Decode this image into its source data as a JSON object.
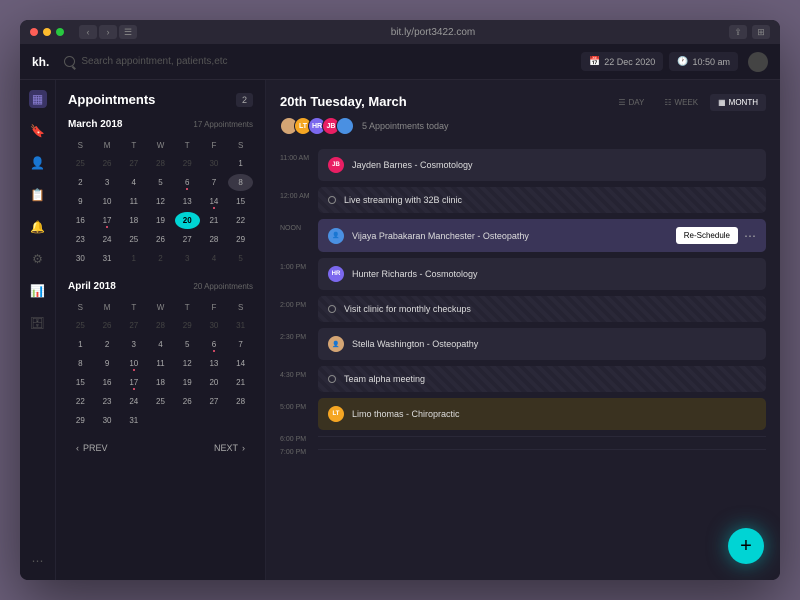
{
  "titlebar": {
    "url": "bit.ly/port3422.com"
  },
  "topbar": {
    "logo": "kh.",
    "search_placeholder": "Search appointment, patients,etc",
    "date": "22 Dec 2020",
    "time": "10:50 am"
  },
  "panel": {
    "title": "Appointments",
    "badge": "2",
    "prev": "PREV",
    "next": "NEXT"
  },
  "cal1": {
    "month": "March 2018",
    "count": "17 Appointments",
    "days": [
      {
        "n": "25",
        "dim": true
      },
      {
        "n": "26",
        "dim": true
      },
      {
        "n": "27",
        "dim": true
      },
      {
        "n": "28",
        "dim": true
      },
      {
        "n": "29",
        "dim": true
      },
      {
        "n": "30",
        "dim": true
      },
      {
        "n": "1"
      },
      {
        "n": "2"
      },
      {
        "n": "3"
      },
      {
        "n": "4"
      },
      {
        "n": "5"
      },
      {
        "n": "6",
        "dot": true
      },
      {
        "n": "7"
      },
      {
        "n": "8",
        "ring": true
      },
      {
        "n": "9"
      },
      {
        "n": "10"
      },
      {
        "n": "11"
      },
      {
        "n": "12"
      },
      {
        "n": "13"
      },
      {
        "n": "14",
        "dot": true
      },
      {
        "n": "15"
      },
      {
        "n": "16"
      },
      {
        "n": "17",
        "dot": true
      },
      {
        "n": "18"
      },
      {
        "n": "19"
      },
      {
        "n": "20",
        "sel": true
      },
      {
        "n": "21"
      },
      {
        "n": "22"
      },
      {
        "n": "23"
      },
      {
        "n": "24"
      },
      {
        "n": "25"
      },
      {
        "n": "26"
      },
      {
        "n": "27"
      },
      {
        "n": "28"
      },
      {
        "n": "29"
      },
      {
        "n": "30"
      },
      {
        "n": "31"
      },
      {
        "n": "1",
        "dim": true
      },
      {
        "n": "2",
        "dim": true
      },
      {
        "n": "3",
        "dim": true
      },
      {
        "n": "4",
        "dim": true
      },
      {
        "n": "5",
        "dim": true
      }
    ]
  },
  "cal2": {
    "month": "April 2018",
    "count": "20 Appointments",
    "days": [
      {
        "n": "25",
        "dim": true
      },
      {
        "n": "26",
        "dim": true
      },
      {
        "n": "27",
        "dim": true
      },
      {
        "n": "28",
        "dim": true
      },
      {
        "n": "29",
        "dim": true
      },
      {
        "n": "30",
        "dim": true
      },
      {
        "n": "31",
        "dim": true
      },
      {
        "n": "1"
      },
      {
        "n": "2"
      },
      {
        "n": "3"
      },
      {
        "n": "4"
      },
      {
        "n": "5"
      },
      {
        "n": "6",
        "dot": true
      },
      {
        "n": "7"
      },
      {
        "n": "8"
      },
      {
        "n": "9"
      },
      {
        "n": "10",
        "dot": true
      },
      {
        "n": "11"
      },
      {
        "n": "12"
      },
      {
        "n": "13"
      },
      {
        "n": "14"
      },
      {
        "n": "15"
      },
      {
        "n": "16"
      },
      {
        "n": "17",
        "dot": true
      },
      {
        "n": "18"
      },
      {
        "n": "19"
      },
      {
        "n": "20"
      },
      {
        "n": "21"
      },
      {
        "n": "22"
      },
      {
        "n": "23"
      },
      {
        "n": "24"
      },
      {
        "n": "25"
      },
      {
        "n": "26"
      },
      {
        "n": "27"
      },
      {
        "n": "28"
      },
      {
        "n": "29"
      },
      {
        "n": "30"
      },
      {
        "n": "31"
      }
    ]
  },
  "dayheaders": [
    "S",
    "M",
    "T",
    "W",
    "T",
    "F",
    "S"
  ],
  "main": {
    "title": "20th Tuesday, March",
    "count": "5 Appointments today",
    "tabs": {
      "day": "DAY",
      "week": "WEEK",
      "month": "MONTH"
    },
    "reschedule": "Re-Schedule"
  },
  "slots": [
    {
      "time": "11:00 AM",
      "type": "apt",
      "av": "JB",
      "col": "#e91e63",
      "text": "Jayden Barnes - Cosmotology"
    },
    {
      "time": "12:00 AM",
      "type": "task",
      "text": "Live streaming with 32B clinic",
      "dashed": true
    },
    {
      "time": "NOON",
      "type": "apt",
      "av": "👤",
      "col": "#4a90e2",
      "text": "Vijaya Prabakaran Manchester - Osteopathy",
      "highlight": true,
      "actions": true
    },
    {
      "time": "1:00 PM",
      "type": "apt",
      "av": "HR",
      "col": "#7b68ee",
      "text": "Hunter Richards - Cosmotology"
    },
    {
      "time": "2:00 PM",
      "type": "task",
      "text": "Visit clinic for monthly checkups",
      "dashed": true
    },
    {
      "time": "2:30 PM",
      "type": "apt",
      "av": "👤",
      "col": "#d4a574",
      "text": "Stella Washington - Osteopathy"
    },
    {
      "time": "4:30 PM",
      "type": "task",
      "text": "Team alpha meeting",
      "dashed": true
    },
    {
      "time": "5:00 PM",
      "type": "apt",
      "av": "LT",
      "col": "#f5a623",
      "text": "Limo thomas - Chiropractic",
      "orange": true
    },
    {
      "time": "6:00 PM",
      "type": "empty"
    },
    {
      "time": "7:00 PM",
      "type": "empty"
    }
  ]
}
